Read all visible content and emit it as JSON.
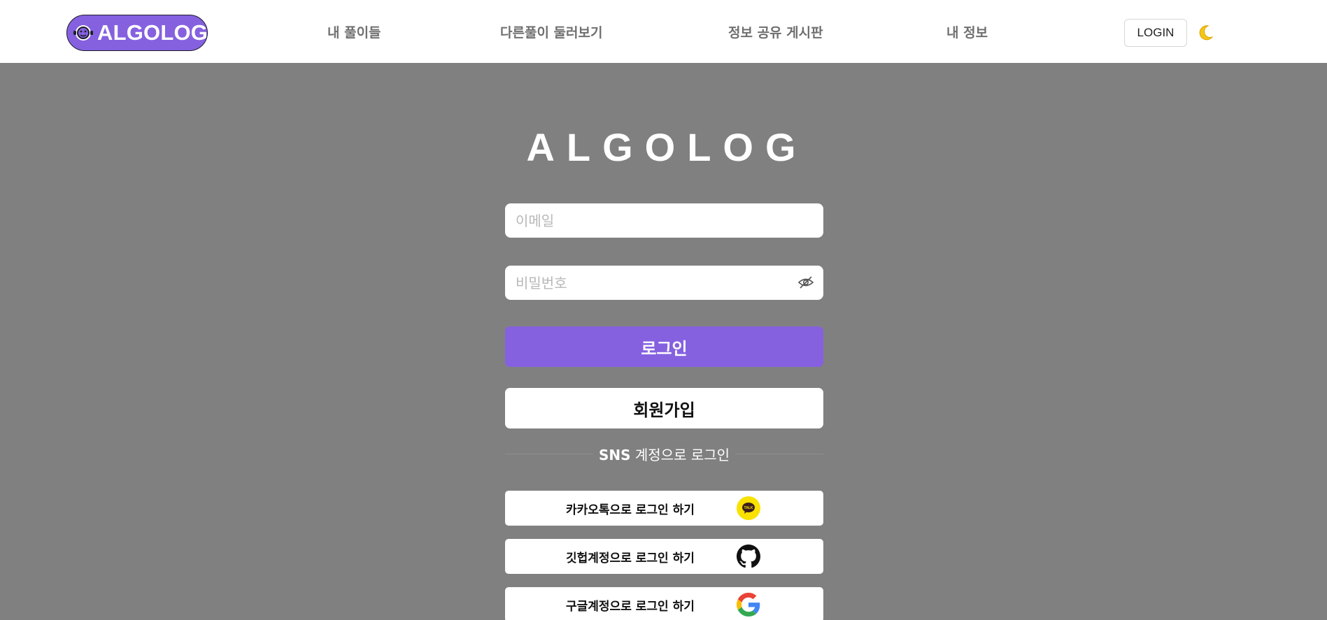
{
  "navbar": {
    "logo_text": "ALGOLOG",
    "links": [
      "내 풀이들",
      "다른풀이 둘러보기",
      "정보 공유 게시판",
      "내 정보"
    ],
    "login_button": "LOGIN",
    "theme_icon": "moon-icon"
  },
  "login": {
    "brand": "ALGOLOG",
    "email_placeholder": "이메일",
    "password_placeholder": "비밀번호",
    "submit_label": "로그인",
    "signup_label": "회원가입",
    "sns_prefix": "SNS",
    "sns_suffix": " 계정으로 로그인",
    "sns_buttons": [
      {
        "label": "카카오톡으로 로그인 하기",
        "icon": "kakao-talk-icon"
      },
      {
        "label": "깃헙계정으로 로그인 하기",
        "icon": "github-icon"
      },
      {
        "label": "구글계정으로 로그인 하기",
        "icon": "google-icon"
      }
    ]
  },
  "colors": {
    "accent": "#8561e0",
    "background": "#808080",
    "kakao_yellow": "#fae100"
  }
}
